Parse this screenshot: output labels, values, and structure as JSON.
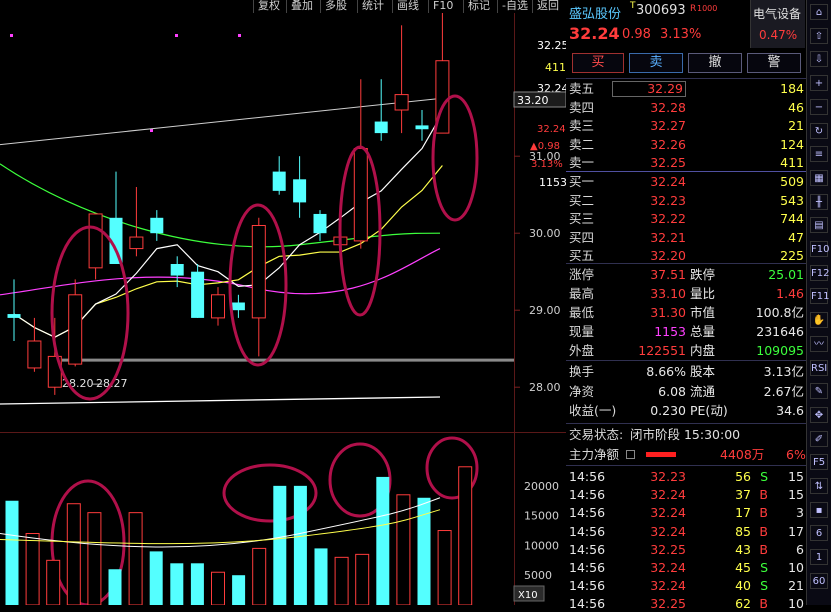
{
  "toolbar": {
    "items": [
      "复权",
      "叠加",
      "多股",
      "统计",
      "画线",
      "F10",
      "标记",
      "-自选",
      "返回"
    ]
  },
  "colors": {
    "up": "#ff3c3c",
    "down": "#54ffff",
    "ma5": "#ffffff",
    "ma10": "#ffff4c",
    "ma20": "#ff40ff",
    "ma60": "#3cff3c",
    "annotation": "#b0104a"
  },
  "stock": {
    "name": "盛弘股份",
    "code": "300693",
    "tag_t": "T",
    "tag_r": "R",
    "tag_rank": "1000",
    "price": "32.24",
    "change": "0.98",
    "change_pct": "3.13%",
    "sector_name": "电气设备",
    "sector_pct": "0.47%"
  },
  "trade_buttons": [
    "买",
    "卖",
    "撤",
    "警"
  ],
  "order_book": {
    "asks": [
      {
        "label": "卖五",
        "price": "32.29",
        "vol": "184"
      },
      {
        "label": "卖四",
        "price": "32.28",
        "vol": "46"
      },
      {
        "label": "卖三",
        "price": "32.27",
        "vol": "21"
      },
      {
        "label": "卖二",
        "price": "32.26",
        "vol": "124"
      },
      {
        "label": "卖一",
        "price": "32.25",
        "vol": "411"
      }
    ],
    "bids": [
      {
        "label": "买一",
        "price": "32.24",
        "vol": "509"
      },
      {
        "label": "买二",
        "price": "32.23",
        "vol": "543"
      },
      {
        "label": "买三",
        "price": "32.22",
        "vol": "744"
      },
      {
        "label": "买四",
        "price": "32.21",
        "vol": "47"
      },
      {
        "label": "买五",
        "price": "32.20",
        "vol": "225"
      }
    ]
  },
  "stats": [
    {
      "l1": "涨停",
      "v1": "37.51",
      "c1": "red",
      "l2": "跌停",
      "v2": "25.01",
      "c2": "green"
    },
    {
      "l1": "最高",
      "v1": "33.10",
      "c1": "red",
      "l2": "量比",
      "v2": "1.46",
      "c2": "red"
    },
    {
      "l1": "最低",
      "v1": "31.30",
      "c1": "red",
      "l2": "市值",
      "v2": "100.8亿",
      "c2": "white"
    },
    {
      "l1": "现量",
      "v1": "1153",
      "c1": "mag",
      "l2": "总量",
      "v2": "231646",
      "c2": "white"
    },
    {
      "l1": "外盘",
      "v1": "122551",
      "c1": "red",
      "l2": "内盘",
      "v2": "109095",
      "c2": "green"
    }
  ],
  "fundamentals": [
    {
      "l1": "换手",
      "v1": "8.66%",
      "l2": "股本",
      "v2": "3.13亿"
    },
    {
      "l1": "净资",
      "v1": "6.08",
      "l2": "流通",
      "v2": "2.67亿"
    },
    {
      "l1": "收益(一)",
      "v1": "0.230",
      "l2": "PE(动)",
      "v2": "34.6"
    }
  ],
  "status": {
    "label": "交易状态:",
    "value": "闭市阶段 15:30:00"
  },
  "main_flow": {
    "label": "主力净额",
    "value": "4408万",
    "pct": "6%"
  },
  "ticks": [
    {
      "time": "14:56",
      "price": "32.23",
      "vol": "56",
      "side": "S",
      "num": "15"
    },
    {
      "time": "14:56",
      "price": "32.24",
      "vol": "37",
      "side": "B",
      "num": "15"
    },
    {
      "time": "14:56",
      "price": "32.24",
      "vol": "17",
      "side": "B",
      "num": "3"
    },
    {
      "time": "14:56",
      "price": "32.24",
      "vol": "85",
      "side": "B",
      "num": "17"
    },
    {
      "time": "14:56",
      "price": "32.25",
      "vol": "43",
      "side": "B",
      "num": "6"
    },
    {
      "time": "14:56",
      "price": "32.24",
      "vol": "45",
      "side": "S",
      "num": "10"
    },
    {
      "time": "14:56",
      "price": "32.24",
      "vol": "40",
      "side": "S",
      "num": "21"
    },
    {
      "time": "14:56",
      "price": "32.25",
      "vol": "62",
      "side": "B",
      "num": "10"
    }
  ],
  "sidebar_icons": [
    "home-icon",
    "up-arrow-icon",
    "down-arrow-icon",
    "zoom-in-icon",
    "zoom-out-icon",
    "refresh-icon",
    "list-icon",
    "grid-icon",
    "kline-icon",
    "table-icon",
    "f10-icon",
    "f12-icon",
    "f11-icon",
    "hand-icon",
    "ma-icon",
    "rsi-icon",
    "brush-icon",
    "move-icon",
    "pen-icon",
    "f5-icon",
    "sort-icon",
    "x10-icon",
    "f6-icon",
    "one-icon",
    "sixty-icon"
  ],
  "sidebar_labels": [
    "",
    "",
    "",
    "",
    "",
    "",
    "",
    "",
    "",
    "",
    "F10",
    "F12",
    "F11",
    "",
    "",
    "RSI",
    "",
    "",
    "",
    "F5",
    "",
    "",
    "6",
    "1",
    "60"
  ],
  "price_axis": {
    "right_top": "32.25",
    "right_411": "411",
    "right_3224": "32.24",
    "crosshair": "33.20",
    "price_red": "32.24",
    "change_red": "▲0.98",
    "pct_red": "3.13%",
    "vol_white": "1153",
    "ticks": [
      "31.00",
      "30.00",
      "29.00",
      "28.00"
    ]
  },
  "low_labels": {
    "a": "28.20",
    "b": "28.27"
  },
  "volume_axis": {
    "ticks": [
      "20000",
      "15000",
      "10000",
      "5000"
    ],
    "unit": "X10"
  },
  "chart_data": {
    "type": "candlestick",
    "candles": [
      {
        "o": 28.9,
        "h": 29.4,
        "l": 28.6,
        "c": 28.95,
        "up": false
      },
      {
        "o": 28.25,
        "h": 28.9,
        "l": 28.2,
        "c": 28.6,
        "up": true
      },
      {
        "o": 28.0,
        "h": 28.9,
        "l": 27.9,
        "c": 28.4,
        "up": true
      },
      {
        "o": 28.3,
        "h": 29.4,
        "l": 28.27,
        "c": 29.2,
        "up": true
      },
      {
        "o": 29.55,
        "h": 30.2,
        "l": 29.4,
        "c": 30.25,
        "up": true
      },
      {
        "o": 30.2,
        "h": 30.8,
        "l": 29.6,
        "c": 29.6,
        "up": false
      },
      {
        "o": 29.8,
        "h": 30.6,
        "l": 29.7,
        "c": 29.95,
        "up": true
      },
      {
        "o": 30.2,
        "h": 30.3,
        "l": 29.9,
        "c": 30.0,
        "up": false
      },
      {
        "o": 29.6,
        "h": 29.7,
        "l": 29.3,
        "c": 29.45,
        "up": false
      },
      {
        "o": 29.5,
        "h": 29.6,
        "l": 28.9,
        "c": 28.9,
        "up": false
      },
      {
        "o": 28.9,
        "h": 29.3,
        "l": 28.8,
        "c": 29.2,
        "up": true
      },
      {
        "o": 29.1,
        "h": 29.2,
        "l": 28.9,
        "c": 29.0,
        "up": false
      },
      {
        "o": 28.9,
        "h": 30.2,
        "l": 28.4,
        "c": 30.1,
        "up": true
      },
      {
        "o": 30.8,
        "h": 31.0,
        "l": 30.5,
        "c": 30.55,
        "up": false
      },
      {
        "o": 30.7,
        "h": 31.0,
        "l": 30.2,
        "c": 30.4,
        "up": false
      },
      {
        "o": 30.25,
        "h": 30.3,
        "l": 29.9,
        "c": 30.0,
        "up": false
      },
      {
        "o": 29.85,
        "h": 30.0,
        "l": 29.8,
        "c": 29.95,
        "up": true
      },
      {
        "o": 29.9,
        "h": 32.0,
        "l": 29.8,
        "c": 31.1,
        "up": true
      },
      {
        "o": 31.45,
        "h": 32.0,
        "l": 31.2,
        "c": 31.3,
        "up": false
      },
      {
        "o": 31.6,
        "h": 32.7,
        "l": 31.3,
        "c": 31.8,
        "up": true
      },
      {
        "o": 31.4,
        "h": 31.6,
        "l": 31.2,
        "c": 31.35,
        "up": false
      },
      {
        "o": 31.3,
        "h": 33.1,
        "l": 31.3,
        "c": 32.24,
        "up": true
      }
    ],
    "volumes": [
      17500,
      12000,
      7500,
      17000,
      15500,
      6000,
      15500,
      9000,
      7000,
      7000,
      5500,
      5000,
      9500,
      20000,
      20000,
      9500,
      8000,
      8500,
      21500,
      18500,
      18000,
      12500,
      23200
    ],
    "ylim_price": [
      27.6,
      32.6
    ],
    "ylim_volume": [
      0,
      23500
    ]
  }
}
